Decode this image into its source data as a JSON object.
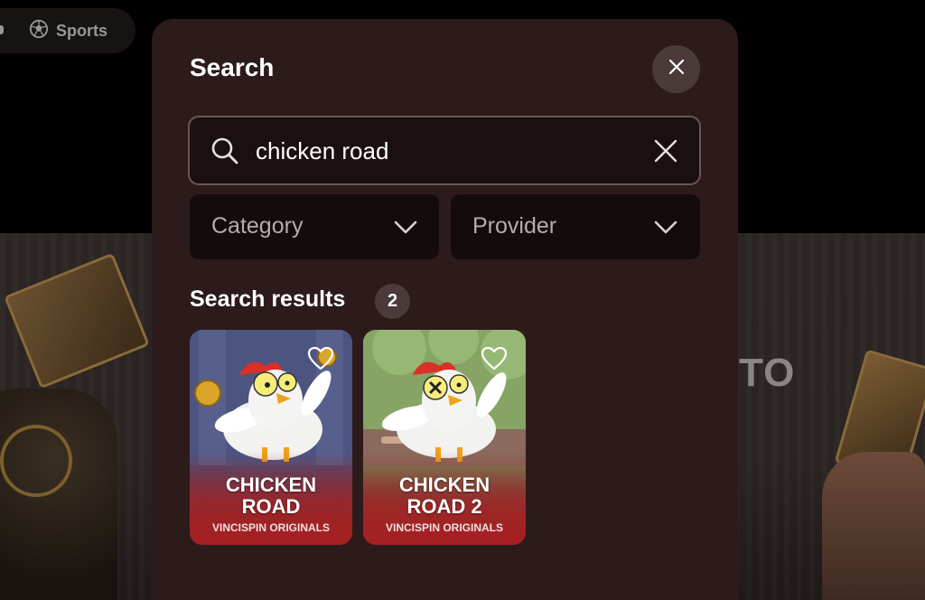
{
  "nav": {
    "sports_label": "Sports"
  },
  "background": {
    "hero_text": "TO"
  },
  "modal": {
    "title": "Search",
    "search": {
      "value": "chicken road",
      "placeholder": ""
    },
    "filters": [
      {
        "label": "Category"
      },
      {
        "label": "Provider"
      }
    ],
    "results": {
      "title": "Search results",
      "count": "2",
      "games": [
        {
          "name_line1": "CHICKEN",
          "name_line2": "ROAD",
          "provider": "VINCISPIN ORIGINALS"
        },
        {
          "name_line1": "CHICKEN",
          "name_line2": "ROAD 2",
          "provider": "VINCISPIN ORIGINALS"
        }
      ]
    }
  },
  "colors": {
    "modal_bg": "#2d1b1b",
    "input_border": "#6a5656",
    "dropdown_bg": "#140c0c",
    "badge_bg": "#4a3a3a"
  },
  "icons": [
    "soccer-ball-icon",
    "close-icon",
    "search-icon",
    "clear-icon",
    "chevron-down-icon",
    "heart-icon"
  ]
}
